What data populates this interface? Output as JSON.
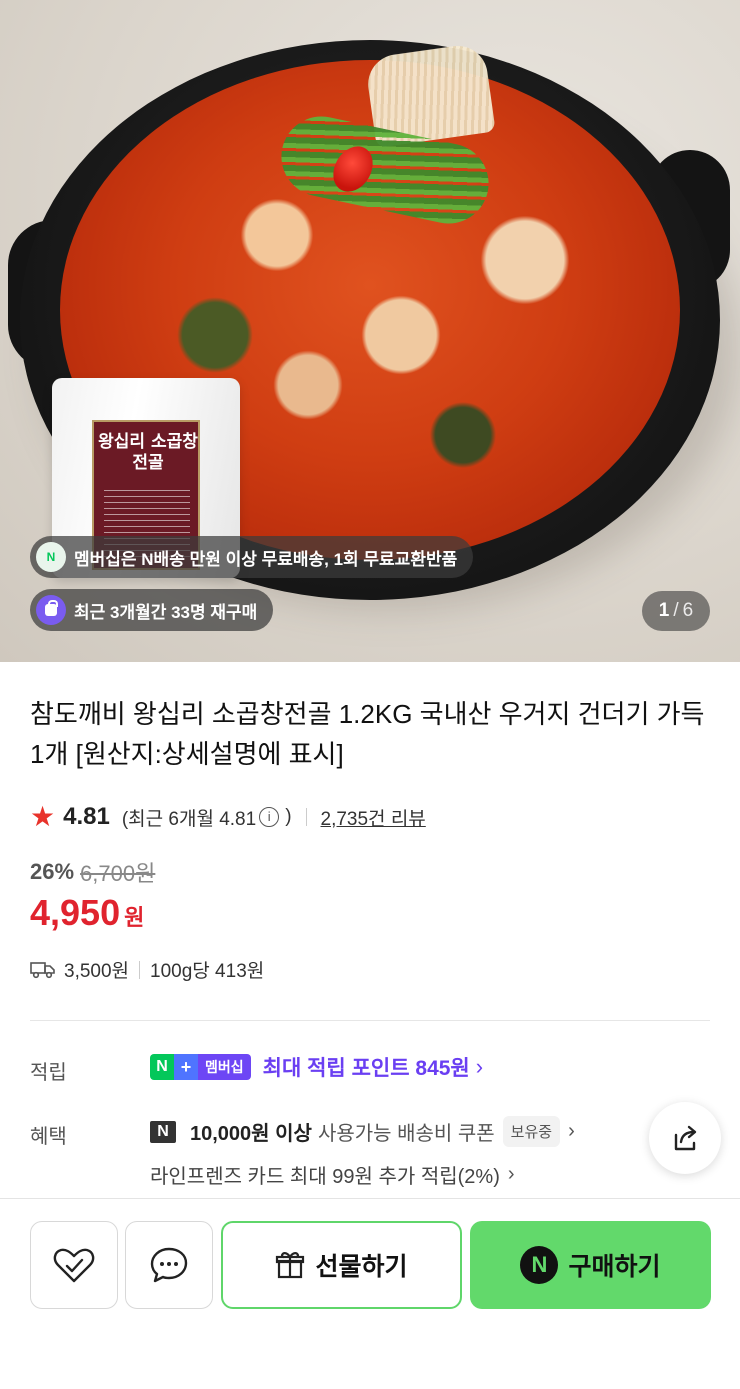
{
  "hero": {
    "package_label": "왕십리 소곱창전골",
    "chip_membership": "멤버십은 N배송 만원 이상 무료배송, 1회 무료교환반품",
    "chip_repurchase": "최근 3개월간 33명 재구매",
    "counter_current": "1",
    "counter_sep": "/",
    "counter_total": "6"
  },
  "product": {
    "title": "참도깨비 왕십리 소곱창전골 1.2KG 국내산 우거지 건더기 가득 1개 [원산지:상세설명에 표시]",
    "rating": "4.81",
    "recent_prefix": "(최근 6개월 4.81",
    "recent_suffix": ")",
    "reviews": "2,735건 리뷰",
    "discount": "26%",
    "original_price": "6,700원",
    "price": "4,950",
    "currency": "원",
    "shipping_fee": "3,500원",
    "unit_price": "100g당 413원"
  },
  "benefits": {
    "point_label": "적립",
    "badge_n": "N",
    "badge_plus": "+",
    "badge_member": "멤버십",
    "point_text": "최대 적립 포인트 845원",
    "benefit_label": "혜택",
    "coupon_logo": "N",
    "coupon_strong": "10,000원 이상",
    "coupon_normal": "사용가능 배송비 쿠폰",
    "coupon_badge": "보유중",
    "card_text": "라인프렌즈 카드 최대 99원 추가 적립(2%)"
  },
  "actions": {
    "gift_label": "선물하기",
    "buy_label": "구매하기",
    "buy_logo": "N"
  },
  "colors": {
    "price_red": "#e0232e",
    "point_purple": "#6a3ff2",
    "naver_green": "#62d96b"
  },
  "icons": [
    "star-icon",
    "info-icon",
    "truck-icon",
    "share-icon",
    "heart-check-icon",
    "chat-icon",
    "gift-icon",
    "naver-n-icon",
    "bag-icon"
  ]
}
